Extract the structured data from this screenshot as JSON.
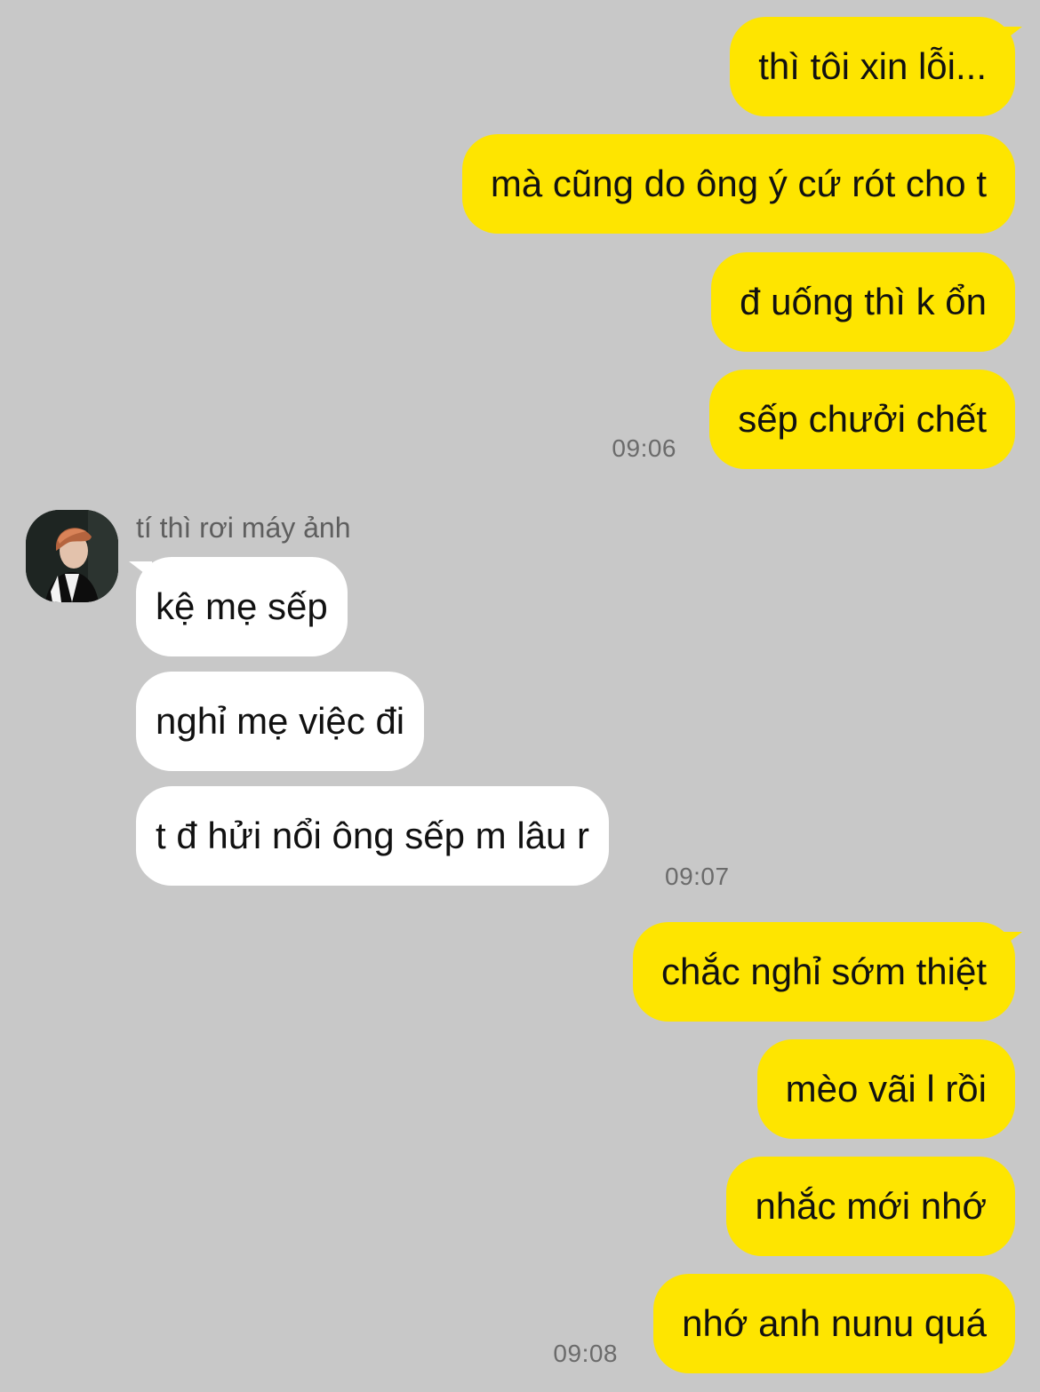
{
  "chat": {
    "sender_name": "tí thì rơi máy ảnh",
    "outgoing_group_1": {
      "messages": [
        "thì tôi xin lỗi...",
        "mà cũng do ông ý cứ rót cho t",
        "đ uống thì k ổn",
        "sếp chưởi chết"
      ],
      "time": "09:06"
    },
    "incoming_group": {
      "messages": [
        "kệ mẹ sếp",
        "nghỉ mẹ việc đi",
        "t đ hửi nổi ông sếp m lâu r"
      ],
      "time": "09:07"
    },
    "outgoing_group_2": {
      "messages": [
        "chắc nghỉ sớm thiệt",
        "mèo vãi l rồi",
        "nhắc mới nhớ",
        "nhớ anh nunu quá"
      ],
      "time": "09:08"
    }
  },
  "colors": {
    "background": "#c8c8c8",
    "outgoing_bubble": "#fee500",
    "incoming_bubble": "#ffffff",
    "timestamp": "#6b6b6b"
  }
}
